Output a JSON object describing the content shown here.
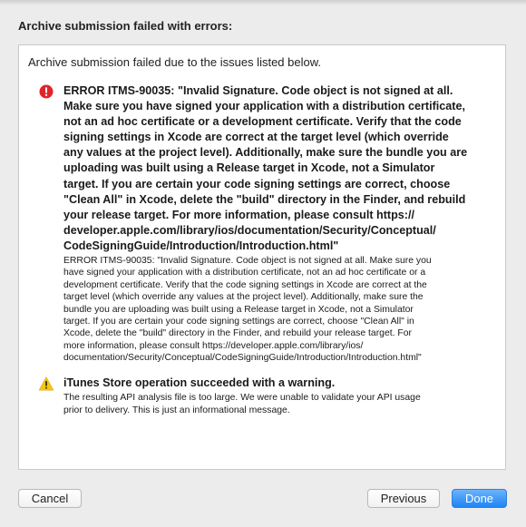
{
  "dialog": {
    "title": "Archive submission failed with errors:",
    "summary": "Archive submission failed due to the issues listed below."
  },
  "issues": [
    {
      "icon": "error-icon",
      "heading_lines": [
        "ERROR ITMS-90035: \"Invalid Signature. Code object is not signed at all.",
        "Make sure you have signed your application with a distribution certificate,",
        "not an ad hoc certificate or a development certificate. Verify that the code",
        "signing settings in Xcode are correct at the target level (which override",
        "any values at the project level). Additionally, make sure the bundle you are",
        "uploading was built using a Release target in Xcode, not a Simulator",
        "target. If you are certain your code signing settings are correct, choose",
        "\"Clean All\" in Xcode, delete the \"build\" directory in the Finder, and rebuild",
        "your release target. For more information, please consult https://",
        "developer.apple.com/library/ios/documentation/Security/Conceptual/",
        "CodeSigningGuide/Introduction/Introduction.html\""
      ],
      "detail_lines": [
        "ERROR ITMS-90035: \"Invalid Signature. Code object is not signed at all. Make sure you",
        "have signed your application with a distribution certificate, not an ad hoc certificate or a",
        "development certificate. Verify that the code signing settings in Xcode are correct at the",
        "target level (which override any values at the project level). Additionally, make sure the",
        "bundle you are uploading was built using a Release target in Xcode, not a Simulator",
        "target. If you are certain your code signing settings are correct, choose \"Clean All\" in",
        "Xcode, delete the \"build\" directory in the Finder, and rebuild your release target. For",
        "more information, please consult https://developer.apple.com/library/ios/",
        "documentation/Security/Conceptual/CodeSigningGuide/Introduction/Introduction.html\""
      ]
    },
    {
      "icon": "warning-icon",
      "heading_lines": [
        "iTunes Store operation succeeded with a warning."
      ],
      "detail_lines": [
        "The resulting API analysis file is too large.  We were unable to validate your API usage",
        "prior to delivery.  This is just an informational message."
      ]
    }
  ],
  "buttons": {
    "cancel": "Cancel",
    "previous": "Previous",
    "done": "Done"
  },
  "colors": {
    "error": "#e0242a",
    "warning": "#f5c518",
    "accent": "#1d84f6"
  }
}
